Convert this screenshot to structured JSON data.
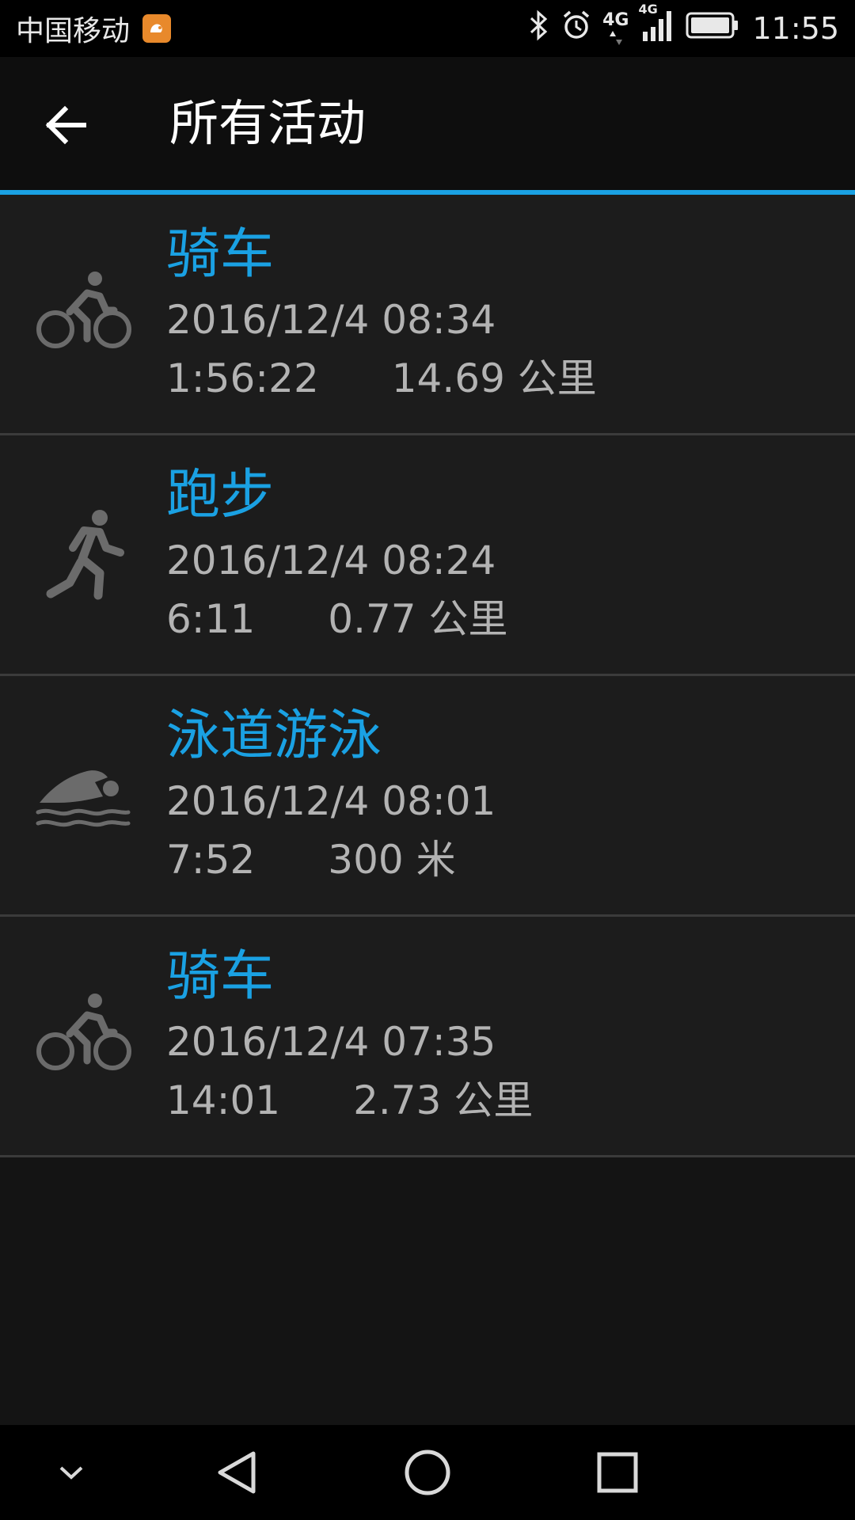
{
  "status_bar": {
    "carrier": "中国移动",
    "time": "11:55",
    "network_primary": "4G",
    "network_secondary": "4G",
    "icons": [
      "uc-browser-icon",
      "bluetooth-icon",
      "alarm-icon",
      "signal-icon",
      "battery-icon"
    ]
  },
  "toolbar": {
    "title": "所有活动",
    "back_icon": "arrow-left-icon"
  },
  "colors": {
    "accent": "#1aa1e3",
    "background": "#141414",
    "item_background": "#1c1c1c",
    "secondary_text": "#b3b3b3",
    "icon_gray": "#6b6b6b"
  },
  "activities": [
    {
      "type_icon": "cycling-icon",
      "name": "骑车",
      "date": "2016/12/4 08:34",
      "duration": "1:56:22",
      "distance": "14.69 公里"
    },
    {
      "type_icon": "running-icon",
      "name": "跑步",
      "date": "2016/12/4 08:24",
      "duration": "6:11",
      "distance": "0.77 公里"
    },
    {
      "type_icon": "swimming-icon",
      "name": "泳道游泳",
      "date": "2016/12/4 08:01",
      "duration": "7:52",
      "distance": "300 米"
    },
    {
      "type_icon": "cycling-icon",
      "name": "骑车",
      "date": "2016/12/4 07:35",
      "duration": "14:01",
      "distance": "2.73 公里"
    }
  ],
  "nav_bar": {
    "icons": [
      "hide-chevron-icon",
      "back-triangle-icon",
      "home-circle-icon",
      "recents-square-icon"
    ]
  }
}
